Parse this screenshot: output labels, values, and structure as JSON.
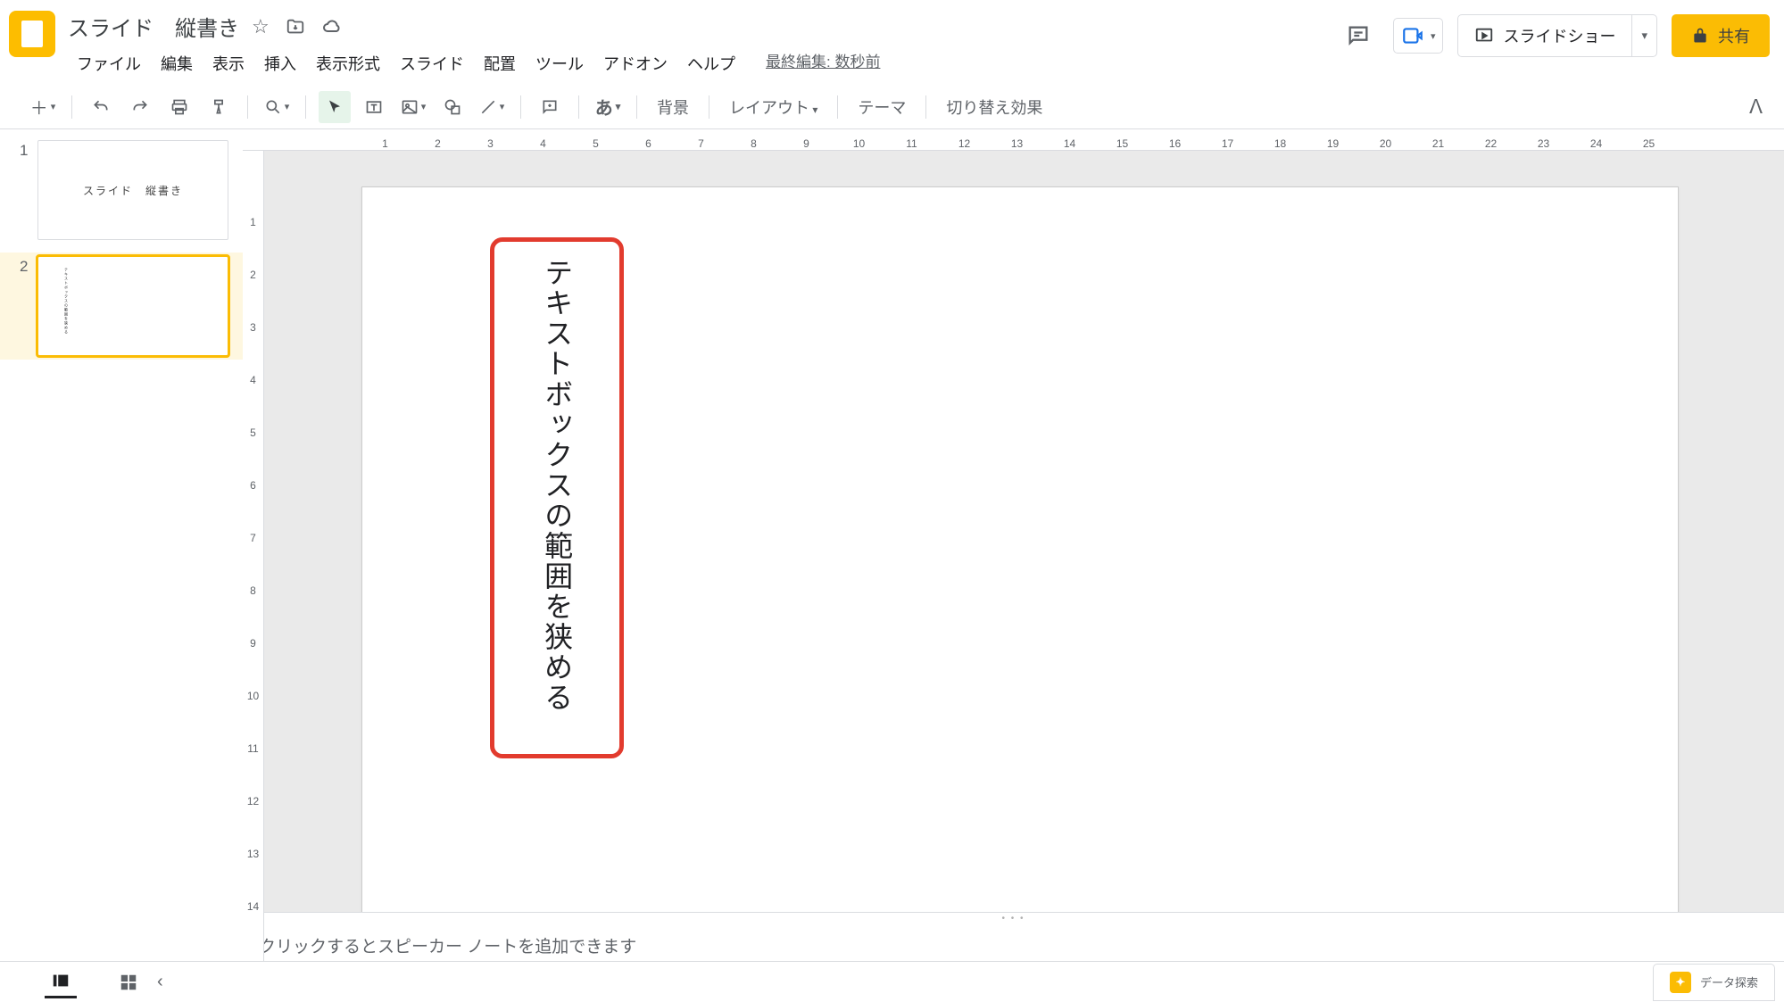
{
  "doc": {
    "title": "スライド　縦書き"
  },
  "menus": {
    "file": "ファイル",
    "edit": "編集",
    "view": "表示",
    "insert": "挿入",
    "format": "表示形式",
    "slide": "スライド",
    "arrange": "配置",
    "tools": "ツール",
    "addons": "アドオン",
    "help": "ヘルプ"
  },
  "header": {
    "last_edit": "最終編集: 数秒前",
    "slideshow": "スライドショー",
    "share": "共有"
  },
  "toolbar": {
    "input_tool": "あ",
    "background": "背景",
    "layout": "レイアウト",
    "theme": "テーマ",
    "transition": "切り替え効果"
  },
  "ruler_h": [
    "1",
    "2",
    "3",
    "4",
    "5",
    "6",
    "7",
    "8",
    "9",
    "10",
    "11",
    "12",
    "13",
    "14",
    "15",
    "16",
    "17",
    "18",
    "19",
    "20",
    "21",
    "22",
    "23",
    "24",
    "25"
  ],
  "ruler_v": [
    "1",
    "2",
    "3",
    "4",
    "5",
    "6",
    "7",
    "8",
    "9",
    "10",
    "11",
    "12",
    "13",
    "14"
  ],
  "thumbnails": [
    {
      "num": "1",
      "text": "スライド　縦書き"
    },
    {
      "num": "2",
      "text": "テキストボックスの範囲を狭める"
    }
  ],
  "slide": {
    "textbox": "テキストボックスの範囲を狭める"
  },
  "notes": {
    "placeholder": "クリックするとスピーカー ノートを追加できます"
  },
  "footer": {
    "explore": "データ探索"
  }
}
